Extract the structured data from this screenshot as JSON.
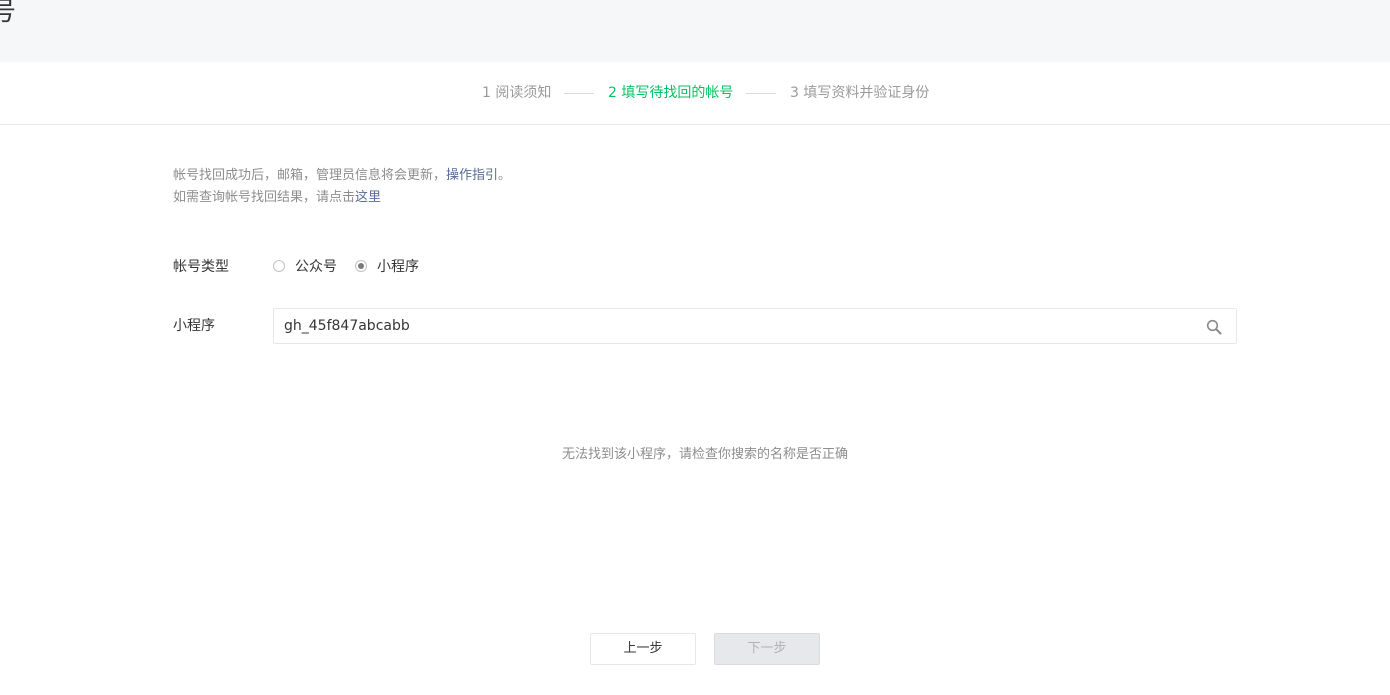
{
  "header": {
    "title_fragment": "号"
  },
  "steps": [
    {
      "label": "1 阅读须知",
      "state": "done"
    },
    {
      "label": "2 填写待找回的帐号",
      "state": "active"
    },
    {
      "label": "3 填写资料并验证身份",
      "state": "pending"
    }
  ],
  "colors": {
    "active_step": "#07c160",
    "link": "#576b95",
    "muted_text": "#8d8d8d"
  },
  "tips": {
    "line1_text": "帐号找回成功后，邮箱，管理员信息将会更新，",
    "line1_link": "操作指引",
    "line1_end": "。",
    "line2_text": "如需查询帐号找回结果，请点击",
    "line2_link": "这里"
  },
  "form": {
    "account_type_label": "帐号类型",
    "account_types": [
      {
        "label": "公众号",
        "checked": false
      },
      {
        "label": "小程序",
        "checked": true
      }
    ],
    "search_label": "小程序",
    "search_value": "gh_45f847abcabb"
  },
  "result": {
    "empty_message": "无法找到该小程序，请检查你搜索的名称是否正确"
  },
  "buttons": {
    "prev_label": "上一步",
    "next_label": "下一步",
    "next_disabled": true
  }
}
